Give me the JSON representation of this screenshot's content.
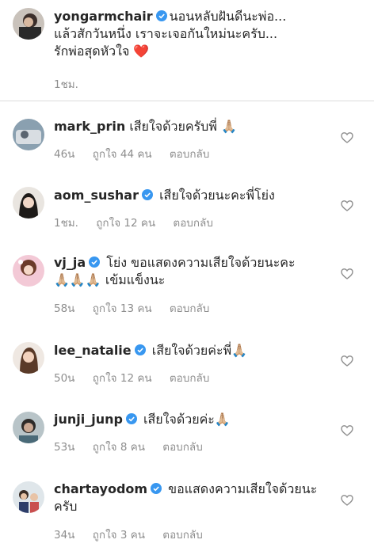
{
  "post": {
    "username": "yongarmchair",
    "lines": [
      "นอนหลับฝันดีนะพ่อ...",
      "แล้วสักวันหนึ่ง เราจะเจอกันใหม่นะครับ...",
      "รักพ่อสุดหัวใจ ❤️"
    ],
    "time": "1ชม."
  },
  "comments": [
    {
      "username": "mark_prin",
      "verified": false,
      "lines": [
        "เสียใจด้วยครับพี่ 🙏🏼"
      ],
      "time": "46น",
      "likes": "ถูกใจ 44 คน",
      "reply": "ตอบกลับ"
    },
    {
      "username": "aom_sushar",
      "verified": true,
      "lines": [
        "เสียใจด้วยนะคะพี่โย่ง"
      ],
      "time": "1ชม.",
      "likes": "ถูกใจ 12 คน",
      "reply": "ตอบกลับ"
    },
    {
      "username": "vj_ja",
      "verified": true,
      "lines": [
        "โย่ง ขอแสดงความเสียใจด้วยนะคะ",
        "🙏🏼🙏🏼🙏🏼 เข้มแข็งนะ"
      ],
      "time": "58น",
      "likes": "ถูกใจ 13 คน",
      "reply": "ตอบกลับ"
    },
    {
      "username": "lee_natalie",
      "verified": true,
      "lines": [
        "เสียใจด้วยค่ะพี่🙏🏼"
      ],
      "time": "50น",
      "likes": "ถูกใจ 12 คน",
      "reply": "ตอบกลับ"
    },
    {
      "username": "junji_junp",
      "verified": true,
      "lines": [
        "เสียใจด้วยค่ะ🙏🏼"
      ],
      "time": "53น",
      "likes": "ถูกใจ 8 คน",
      "reply": "ตอบกลับ"
    },
    {
      "username": "chartayodom",
      "verified": true,
      "lines": [
        "ขอแสดงความเสียใจด้วยนะ",
        "ครับ"
      ],
      "time": "34น",
      "likes": "ถูกใจ 3 คน",
      "reply": "ตอบกลับ"
    }
  ],
  "colors": {
    "verified": "#3897f0",
    "heart_outline": "#8e8e8e",
    "red_heart": "#ed4956"
  }
}
